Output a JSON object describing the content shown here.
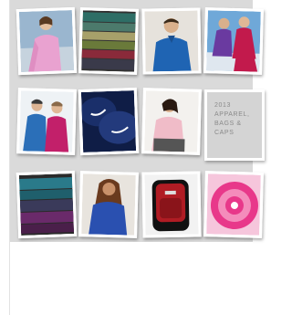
{
  "title_tile": {
    "line1": "2013",
    "line2": "APPAREL,",
    "line3": "BAGS &",
    "line4": "CAPS"
  },
  "photos": [
    {
      "subject": "woman in pink polo",
      "colors": [
        "#e9a2d0",
        "#7ea4c8"
      ]
    },
    {
      "subject": "stack of folded shirts",
      "colors": [
        "#4c7a6c",
        "#a7a06a",
        "#8a2a3a"
      ]
    },
    {
      "subject": "man in blue polo",
      "colors": [
        "#1f64b3",
        "#d9c3a3"
      ]
    },
    {
      "subject": "people in magenta and red jackets",
      "colors": [
        "#c21a4c",
        "#6a3aa0"
      ]
    },
    {
      "subject": "couple in blue and pink jackets",
      "colors": [
        "#2b6fb8",
        "#c2206a"
      ]
    },
    {
      "subject": "navy caps with swoosh",
      "colors": [
        "#13265c",
        "#ffffff"
      ]
    },
    {
      "subject": "woman in pink shirt",
      "colors": [
        "#f0bcc8",
        "#555555"
      ]
    },
    {
      "subject": "stack of dark polos",
      "colors": [
        "#2a7a8a",
        "#6a2a6a",
        "#2a2a2a"
      ]
    },
    {
      "subject": "woman in blue t-shirt",
      "colors": [
        "#2a50b0",
        "#7a4a2a"
      ]
    },
    {
      "subject": "red and black backpack",
      "colors": [
        "#b01c24",
        "#111111"
      ]
    },
    {
      "subject": "pink tie-dye shirt",
      "colors": [
        "#e8388a",
        "#ffffff"
      ]
    }
  ]
}
